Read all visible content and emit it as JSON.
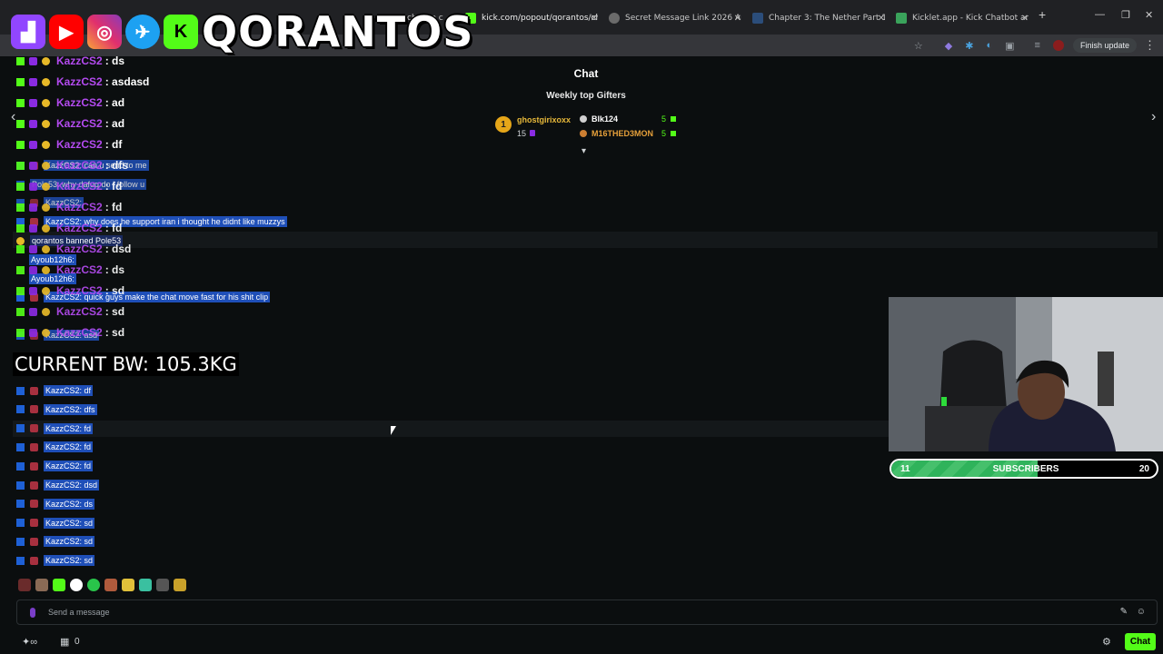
{
  "browser": {
    "tabs": [
      {
        "label": "ch Live c",
        "active": false
      },
      {
        "label": "kick.com/popout/qorantos/cha",
        "active": true
      },
      {
        "label": "Secret Message Link 2026 Anc",
        "active": false
      },
      {
        "label": "Chapter 3: The Nether Part 1 -",
        "active": false
      },
      {
        "label": "Kicklet.app - Kick Chatbot and",
        "active": false
      }
    ],
    "finish_update": "Finish update"
  },
  "overlay": {
    "logo_text": "QORANTOS",
    "bw_label": "CURRENT BW: 105.3KG"
  },
  "chat": {
    "title": "Chat",
    "gifters_title": "Weekly top Gifters",
    "gifters": [
      {
        "rank": "1",
        "name": "ghostgirixoxx",
        "count": "15"
      },
      {
        "name": "Blk124",
        "count": "5"
      },
      {
        "name": "M16THED3MON",
        "count": "5"
      }
    ],
    "big_lines": [
      {
        "user": "KazzCS2",
        "text": ": ds"
      },
      {
        "user": "KazzCS2",
        "text": ": asdasd"
      },
      {
        "user": "KazzCS2",
        "text": ": ad"
      },
      {
        "user": "KazzCS2",
        "text": ": ad"
      },
      {
        "user": "KazzCS2",
        "text": ": df"
      },
      {
        "user": "KazzCS2",
        "text": ": dfs"
      },
      {
        "user": "KazzCS2",
        "text": ": fd"
      },
      {
        "user": "KazzCS2",
        "text": ": fd"
      },
      {
        "user": "KazzCS2",
        "text": ": fd"
      },
      {
        "user": "KazzCS2",
        "text": ": dsd"
      },
      {
        "user": "KazzCS2",
        "text": ": ds"
      },
      {
        "user": "KazzCS2",
        "text": ": sd"
      },
      {
        "user": "KazzCS2",
        "text": ": sd"
      },
      {
        "user": "KazzCS2",
        "text": ": sd"
      }
    ],
    "ghost_lines": [
      "KazzCS2: can u send to me",
      "Pole53: why dafuq do i follow u",
      "KazzCS2:",
      "KazzCS2: why does he support iran i thought he didnt like muzzys",
      "qorantos banned Pole53",
      "Ayoub12h6:",
      "Ayoub12h6:",
      "KazzCS2: quick guys make the chat move fast for his shit clip",
      "KazzCS2: asd"
    ],
    "selected_lines": [
      "KazzCS2: df",
      "KazzCS2: dfs",
      "KazzCS2: fd",
      "KazzCS2: fd",
      "KazzCS2: fd",
      "KazzCS2: dsd",
      "KazzCS2: ds",
      "KazzCS2: sd",
      "KazzCS2: sd",
      "KazzCS2: sd"
    ],
    "input_placeholder": "Send a message",
    "viewer_count": "0",
    "chat_button": "Chat"
  },
  "subscribers": {
    "current": "11",
    "label": "SUBSCRIBERS",
    "goal": "20",
    "progress": 0.55
  },
  "colors": {
    "kick_green": "#53fc18",
    "username_purple": "#b44bf0",
    "selection_blue": "#1f4fb8"
  }
}
